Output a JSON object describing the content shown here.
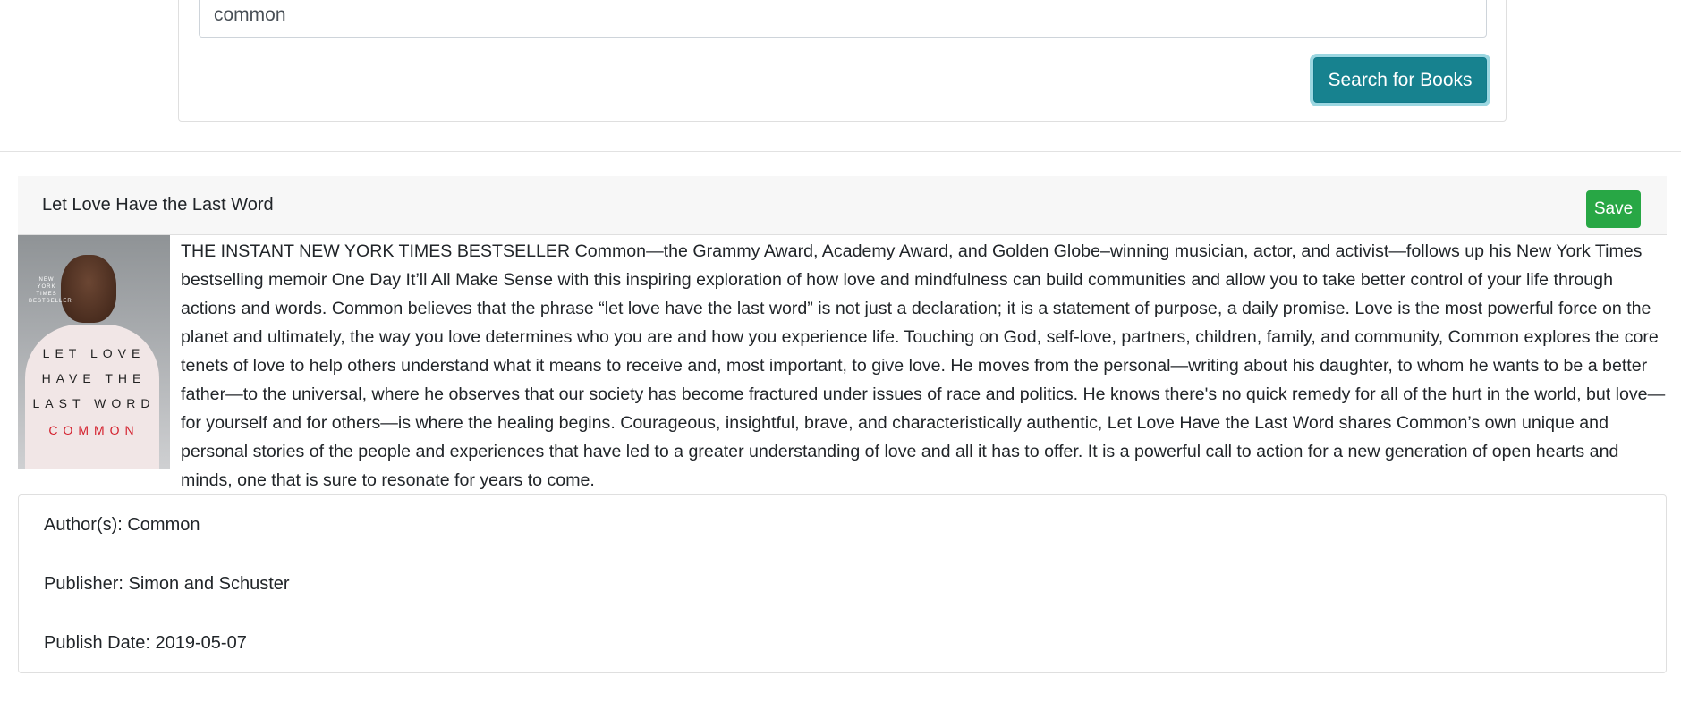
{
  "search": {
    "value": "common",
    "button_label": "Search for Books"
  },
  "book": {
    "title": "Let Love Have the Last Word",
    "save_label": "Save",
    "cover": {
      "small_text": "NEW YORK TIMES BESTSELLER",
      "line1": "LET LOVE",
      "line2": "HAVE THE",
      "line3": "LAST WORD",
      "line4": "COMMON"
    },
    "description": "THE INSTANT NEW YORK TIMES BESTSELLER Common—the Grammy Award, Academy Award, and Golden Globe–winning musician, actor, and activist—follows up his New York Times bestselling memoir One Day It’ll All Make Sense with this inspiring exploration of how love and mindfulness can build communities and allow you to take better control of your life through actions and words. Common believes that the phrase “let love have the last word” is not just a declaration; it is a statement of purpose, a daily promise. Love is the most powerful force on the planet and ultimately, the way you love determines who you are and how you experience life. Touching on God, self-love, partners, children, family, and community, Common explores the core tenets of love to help others understand what it means to receive and, most important, to give love. He moves from the personal—writing about his daughter, to whom he wants to be a better father—to the universal, where he observes that our society has become fractured under issues of race and politics. He knows there's no quick remedy for all of the hurt in the world, but love—for yourself and for others—is where the healing begins. Courageous, insightful, brave, and characteristically authentic, Let Love Have the Last Word shares Common’s own unique and personal stories of the people and experiences that have led to a greater understanding of love and all it has to offer. It is a powerful call to action for a new generation of open hearts and minds, one that is sure to resonate for years to come.",
    "authors": "Author(s): Common",
    "publisher": "Publisher: Simon and Schuster",
    "publish_date": "Publish Date: 2019-05-07"
  },
  "colors": {
    "search_button": "#17828f",
    "save_button": "#28a745",
    "cover_accent": "#d4202d"
  }
}
